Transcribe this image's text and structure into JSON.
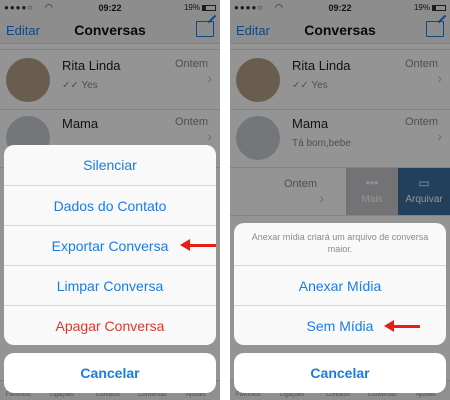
{
  "status_bar": {
    "carrier": "●●●●○",
    "wifi": "wifi-icon",
    "time": "09:22",
    "battery": "19%"
  },
  "nav": {
    "edit_label": "Editar",
    "title": "Conversas",
    "compose_icon": "compose-icon"
  },
  "chats": [
    {
      "name": "Rita Linda",
      "date": "Ontem",
      "preview": "✓✓ Yes"
    },
    {
      "name": "Mama",
      "date": "Ontem",
      "preview": "Tá bom,bebe"
    },
    {
      "date": "Ontem"
    }
  ],
  "swipe_actions": {
    "more_label": "Mais",
    "archive_label": "Arquivar"
  },
  "tab_labels": [
    "Favoritos",
    "Ligações",
    "Contatos",
    "Conversas",
    "Ajustes"
  ],
  "left_sheet": {
    "items": [
      "Silenciar",
      "Dados do Contato",
      "Exportar Conversa",
      "Limpar Conversa",
      "Apagar Conversa"
    ],
    "cancel_label": "Cancelar"
  },
  "right_sheet": {
    "message": "Anexar mídia criará um arquivo de conversa maior.",
    "items": [
      "Anexar Mídia",
      "Sem Mídia"
    ],
    "cancel_label": "Cancelar"
  },
  "colors": {
    "ios_blue": "#1a7ce8",
    "destructive_red": "#e0372d",
    "arrow_red": "#e22018",
    "archive_blue": "#3b6e9e",
    "more_gray": "#c7c7cc"
  }
}
